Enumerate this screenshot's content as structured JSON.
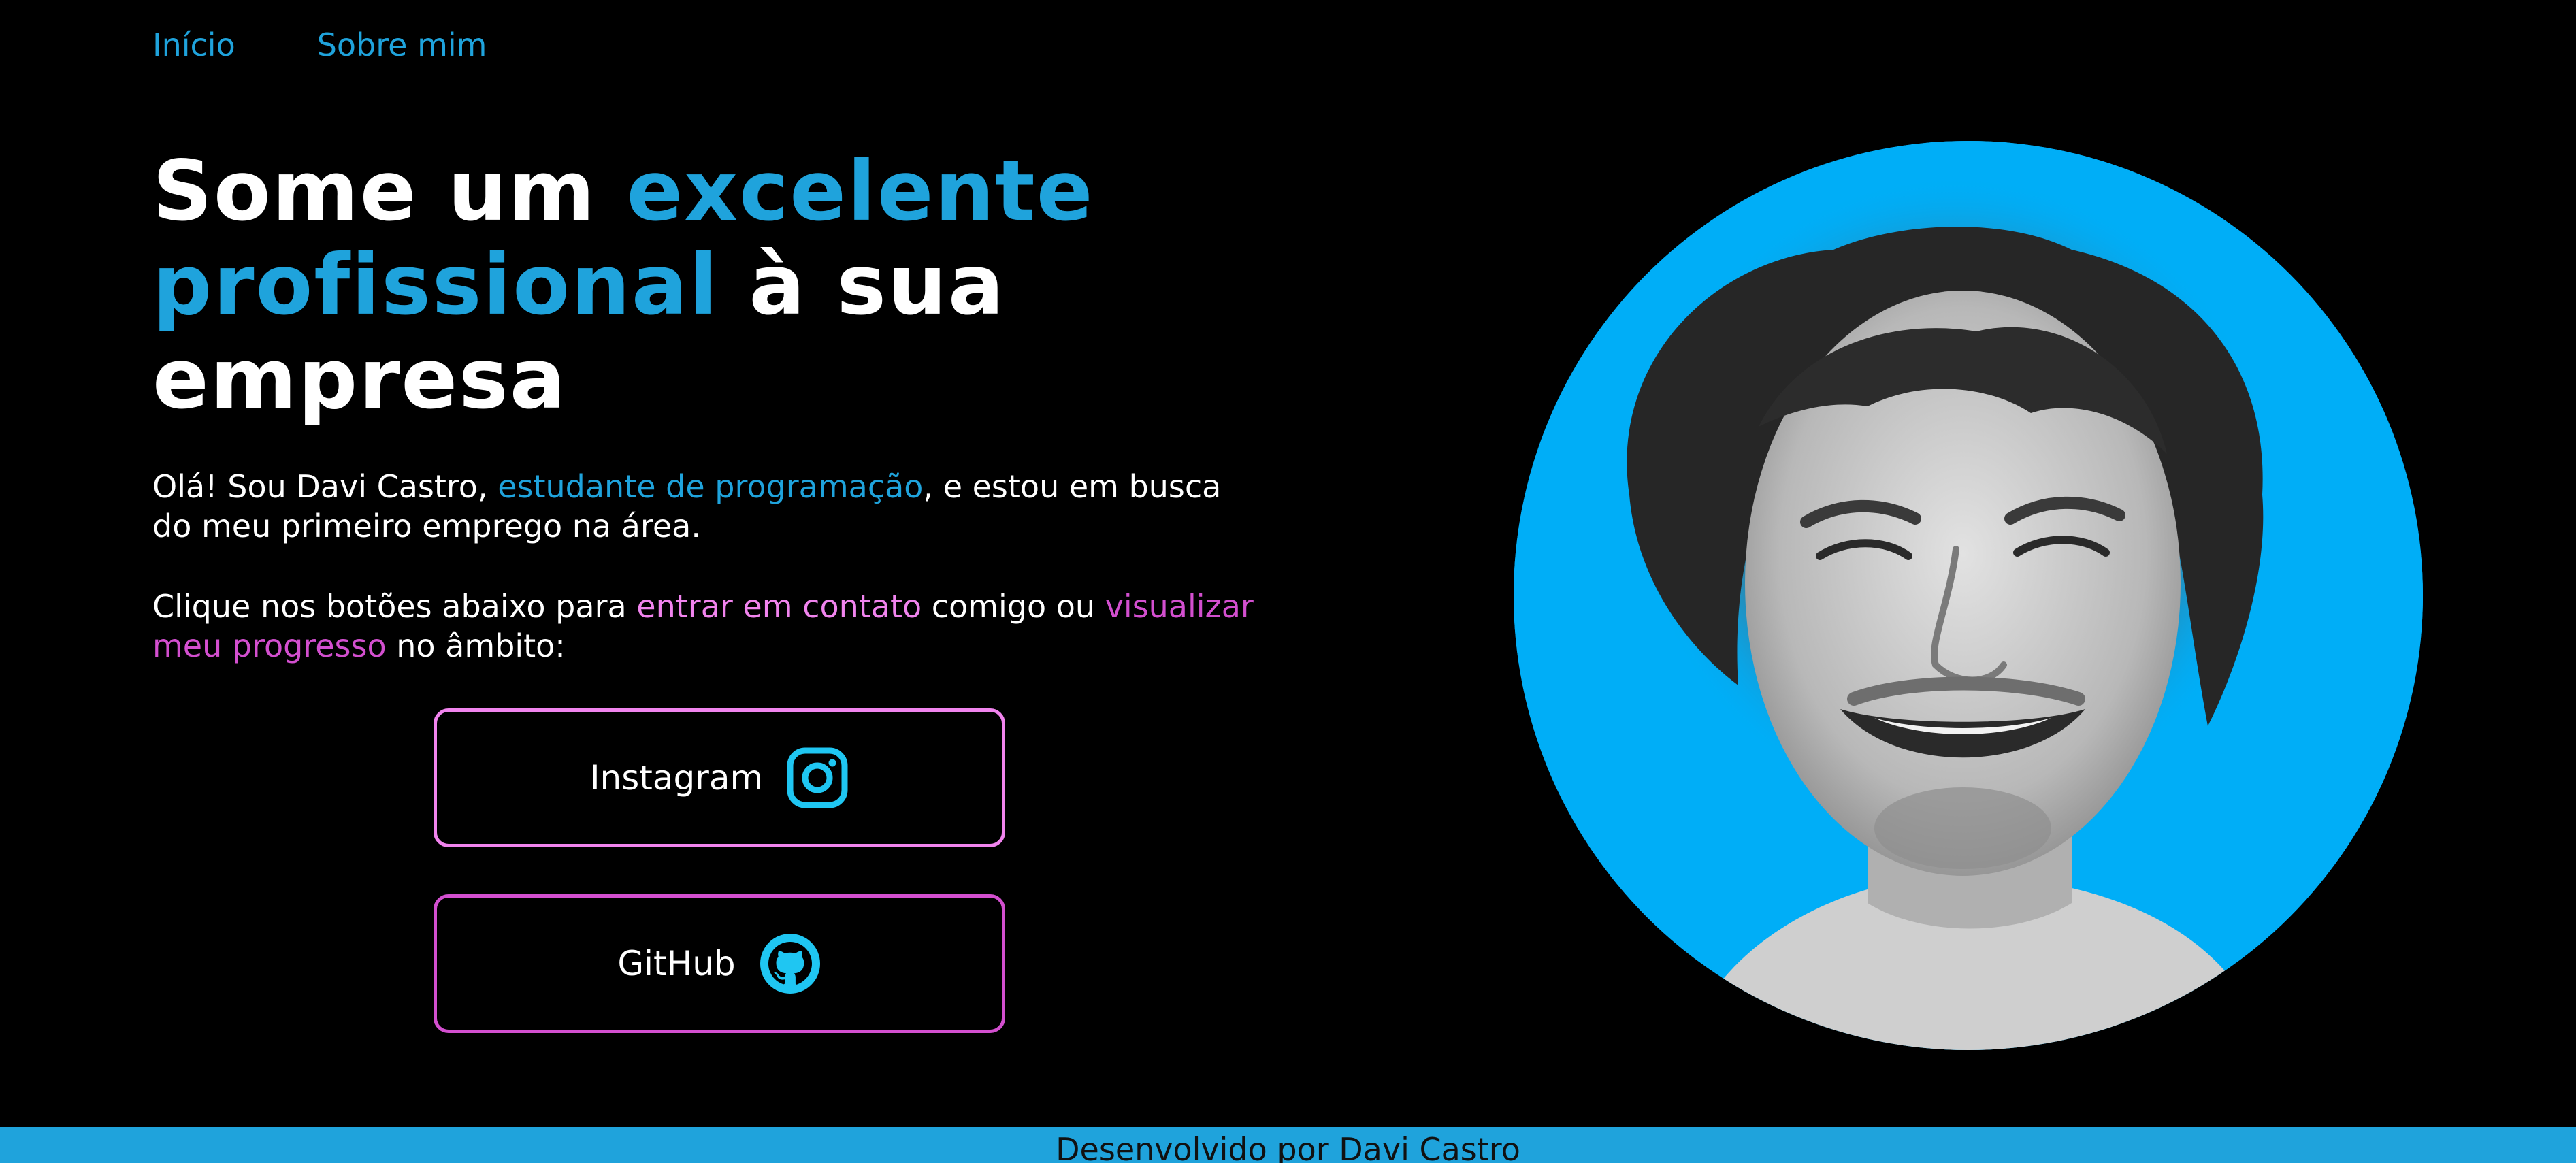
{
  "nav": {
    "items": [
      {
        "label": "Início"
      },
      {
        "label": "Sobre mim"
      }
    ]
  },
  "hero": {
    "headline": {
      "part1": "Some um ",
      "accent1": "excelente",
      "accent2": "profissional",
      "part2": " à sua",
      "part3": "empresa"
    },
    "intro": {
      "part1": "Olá! Sou Davi Castro, ",
      "highlight": "estudante de programação",
      "part2": ", e estou em busca do meu primeiro emprego na área."
    },
    "cta": {
      "part1": "Clique nos botões abaixo para ",
      "highlight1": "entrar em contato",
      "part2": " comigo ou ",
      "highlight2": "visualizar meu progresso",
      "part3": " no âmbito:"
    }
  },
  "buttons": {
    "instagram": {
      "label": "Instagram",
      "icon": "instagram-icon"
    },
    "github": {
      "label": "GitHub",
      "icon": "github-icon"
    }
  },
  "portrait": {
    "icon": "profile-photo"
  },
  "footer": {
    "text": "Desenvolvido por Davi Castro"
  },
  "colors": {
    "background": "#000000",
    "accent_blue": "#1fa3dc",
    "photo_bg": "#00aef7",
    "pink": "#f184ee",
    "magenta": "#d34fcf"
  }
}
